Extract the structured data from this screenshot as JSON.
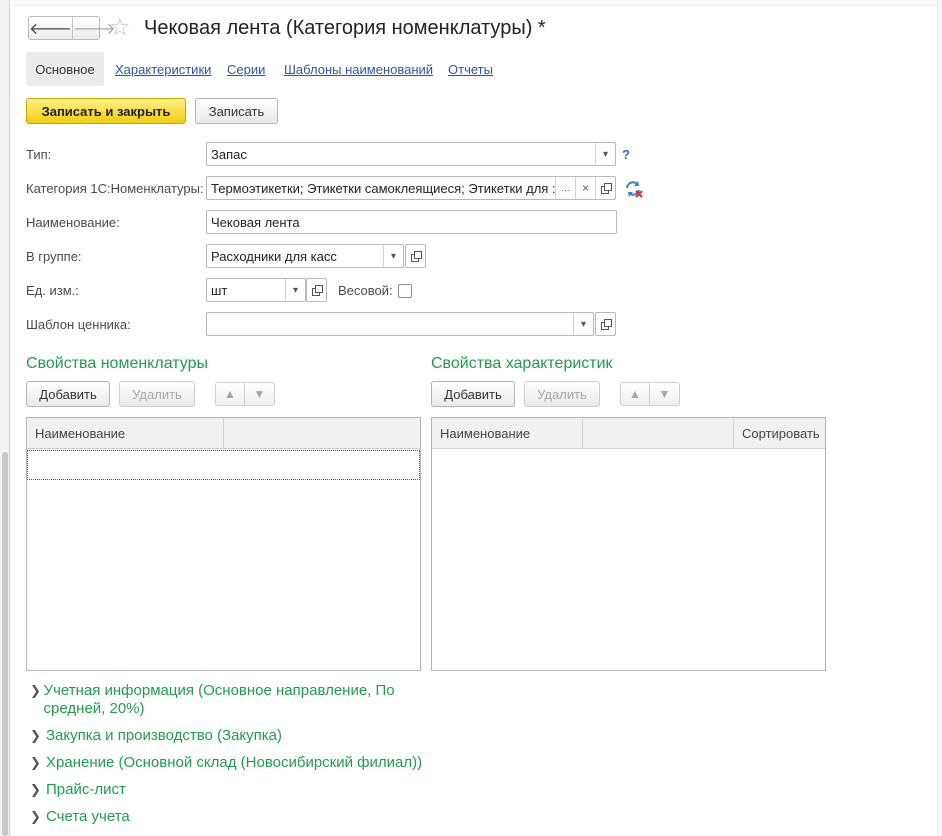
{
  "window": {
    "title": "Чековая лента (Категория номенклатуры) *"
  },
  "nav": {
    "back_glyph": "🡐",
    "forward_glyph": "🡒",
    "favorite_glyph": "☆"
  },
  "tabs": [
    {
      "label": "Основное",
      "active": true
    },
    {
      "label": "Характеристики",
      "active": false
    },
    {
      "label": "Серии",
      "active": false
    },
    {
      "label": "Шаблоны наименований",
      "active": false
    },
    {
      "label": "Отчеты",
      "active": false
    }
  ],
  "toolbar": {
    "save_close_label": "Записать и закрыть",
    "save_label": "Записать"
  },
  "form": {
    "type": {
      "label": "Тип:",
      "value": "Запас",
      "help": "?"
    },
    "category": {
      "label": "Категория 1С:Номенклатуры:",
      "value": "Термоэтикетки; Этикетки самоклеящиеся; Этикетки для :",
      "select_glyph": "...",
      "clear_glyph": "×"
    },
    "name": {
      "label": "Наименование:",
      "value": "Чековая лента"
    },
    "group": {
      "label": "В группе:",
      "value": "Расходники для касс"
    },
    "unit": {
      "label": "Ед. изм.:",
      "value": "шт"
    },
    "weight": {
      "label": "Весовой:",
      "checked": false
    },
    "price_tag": {
      "label": "Шаблон ценника:",
      "value": ""
    }
  },
  "props_nomenclature": {
    "title": "Свойства номенклатуры",
    "add_label": "Добавить",
    "delete_label": "Удалить",
    "columns": [
      "Наименование",
      ""
    ],
    "rows": []
  },
  "props_characteristics": {
    "title": "Свойства характеристик",
    "add_label": "Добавить",
    "delete_label": "Удалить",
    "columns": [
      "Наименование",
      "",
      "Сортировать"
    ],
    "rows": []
  },
  "groups": [
    {
      "label": "Учетная информация (Основное направление, По средней, 20%)"
    },
    {
      "label": "Закупка и производство (Закупка)"
    },
    {
      "label": "Хранение (Основной склад (Новосибирский филиал))"
    },
    {
      "label": "Прайс-лист"
    },
    {
      "label": "Счета учета"
    }
  ],
  "colors": {
    "accent_green": "#1e9e4a",
    "link_blue": "#2b56a7",
    "primary_yellow": "#f2cd0e"
  }
}
